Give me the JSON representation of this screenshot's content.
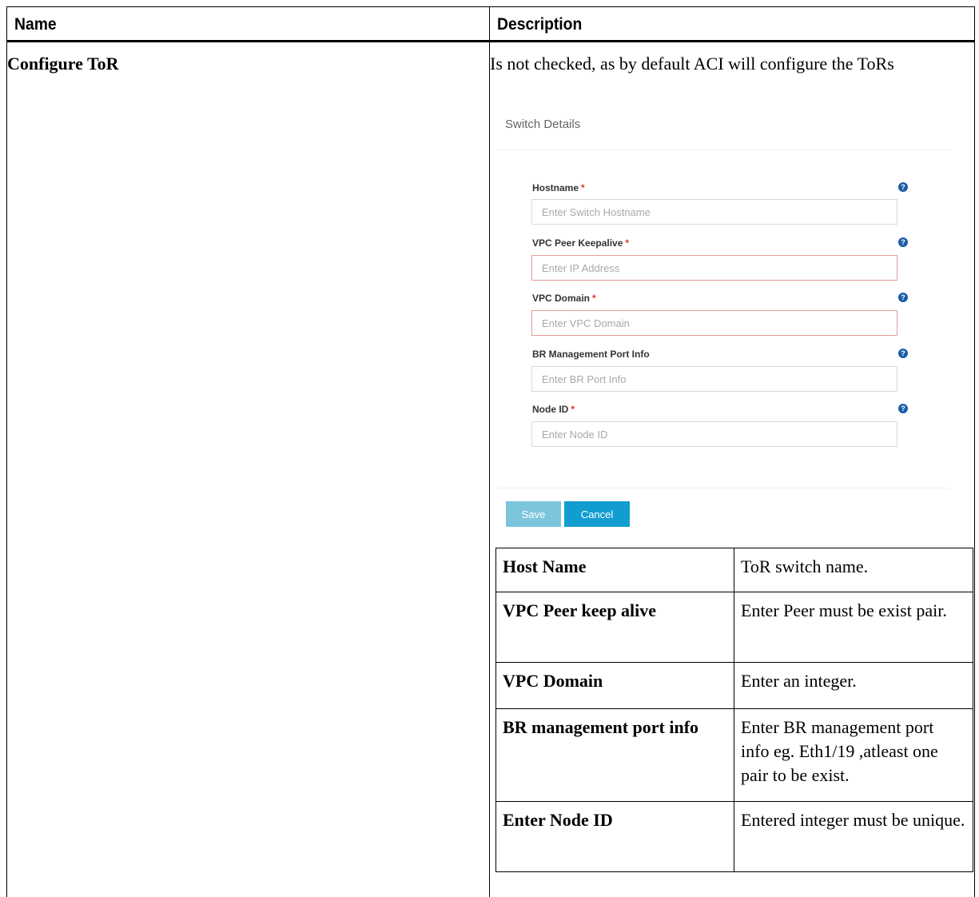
{
  "table": {
    "headers": [
      "Name",
      "Description"
    ],
    "row_name": "Configure ToR",
    "row_description": "Is not checked, as by default ACI will configure the ToRs"
  },
  "form": {
    "title": "Switch Details",
    "fields": [
      {
        "label": "Hostname",
        "required": "*",
        "placeholder": "Enter Switch Hostname"
      },
      {
        "label": "VPC Peer Keepalive",
        "required": "*",
        "placeholder": "Enter IP Address"
      },
      {
        "label": "VPC Domain",
        "required": "*",
        "placeholder": "Enter VPC Domain"
      },
      {
        "label": "BR Management Port Info",
        "required": "",
        "placeholder": "Enter BR Port Info"
      },
      {
        "label": "Node ID",
        "required": "*",
        "placeholder": "Enter Node ID"
      }
    ],
    "help_glyph": "?",
    "save_label": "Save",
    "cancel_label": "Cancel"
  },
  "sub_table": [
    {
      "name": "Host Name",
      "desc": "ToR switch name."
    },
    {
      "name": "VPC Peer keep alive",
      "desc": "Enter Peer must be exist pair."
    },
    {
      "name": "VPC Domain",
      "desc": "Enter an integer."
    },
    {
      "name": "BR management port info",
      "desc": "Enter BR management port info eg. Eth1/19 ,atleast one pair to be exist."
    },
    {
      "name": "Enter Node ID",
      "desc": "Entered integer must be unique."
    }
  ],
  "colors": {
    "required": "#e0342f",
    "help_icon": "#1b5ea8",
    "error_border": "#e99b9b",
    "save_button": "#7cc6dd",
    "cancel_button": "#119dcf"
  },
  "icons": {
    "help": "help-circle-icon"
  }
}
